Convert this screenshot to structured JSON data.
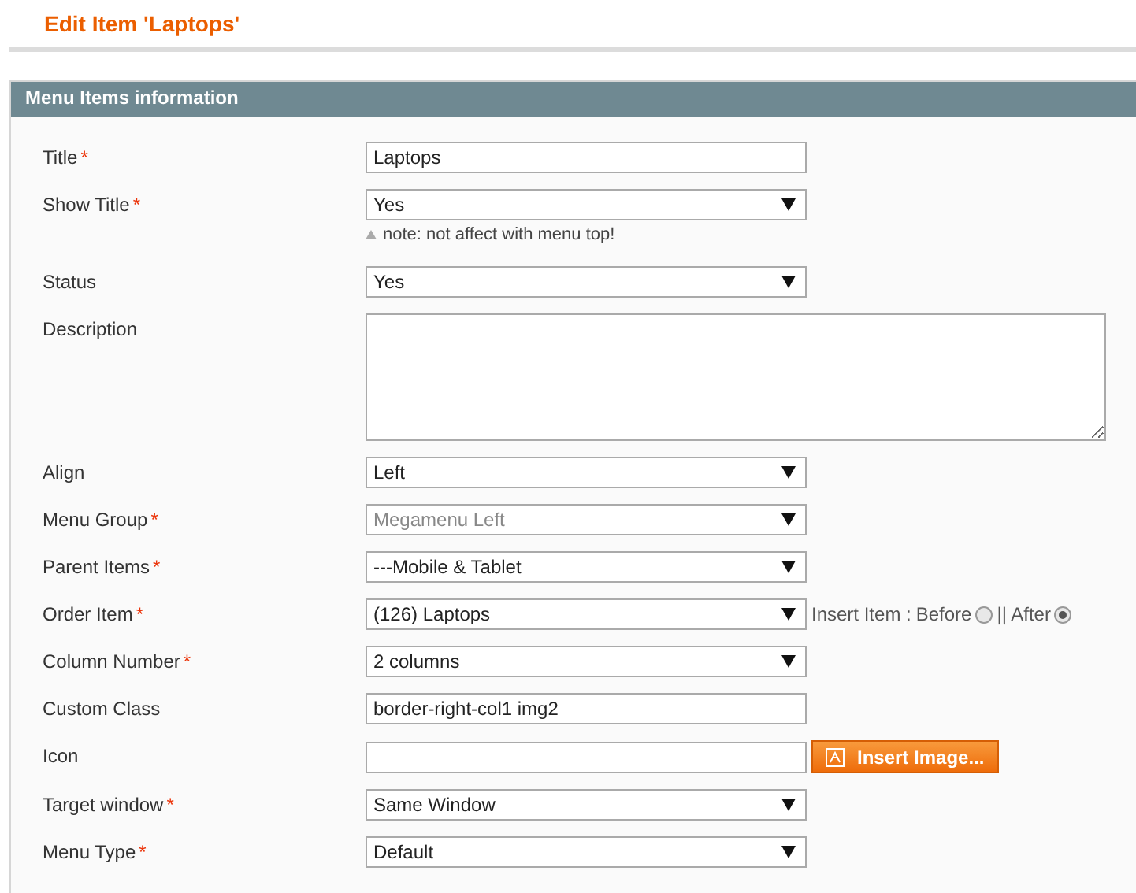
{
  "page_title": "Edit Item 'Laptops'",
  "panel": {
    "title": "Menu Items information",
    "fields": [
      {
        "label": "Title",
        "required_mark": "*",
        "kind": "text",
        "value": "Laptops"
      },
      {
        "label": "Show Title",
        "required_mark": "*",
        "kind": "select",
        "value": "Yes",
        "note": "note: not affect with menu top!"
      },
      {
        "label": "Status",
        "kind": "select",
        "value": "Yes"
      },
      {
        "label": "Description",
        "kind": "textarea"
      },
      {
        "label": "Align",
        "kind": "select",
        "value": "Left"
      },
      {
        "label": "Menu Group",
        "required_mark": "*",
        "kind": "select",
        "value": "Megamenu Left",
        "disabled": true
      },
      {
        "label": "Parent Items",
        "required_mark": "*",
        "kind": "select",
        "value": "---Mobile & Tablet"
      },
      {
        "label": "Order Item",
        "required_mark": "*",
        "kind": "select",
        "value": "(126) Laptops",
        "insert": {
          "label": "Insert Item :",
          "options": [
            {
              "label": "Before",
              "selected": false
            },
            {
              "label": "|| After",
              "selected": true
            }
          ]
        }
      },
      {
        "label": "Column Number",
        "required_mark": "*",
        "kind": "select",
        "value": "2 columns"
      },
      {
        "label": "Custom Class",
        "kind": "text",
        "value": "border-right-col1 img2"
      },
      {
        "label": "Icon",
        "kind": "text",
        "button": "Insert Image..."
      },
      {
        "label": "Target window",
        "required_mark": "*",
        "kind": "select",
        "value": "Same Window"
      },
      {
        "label": "Menu Type",
        "required_mark": "*",
        "kind": "select",
        "value": "Default"
      }
    ]
  }
}
